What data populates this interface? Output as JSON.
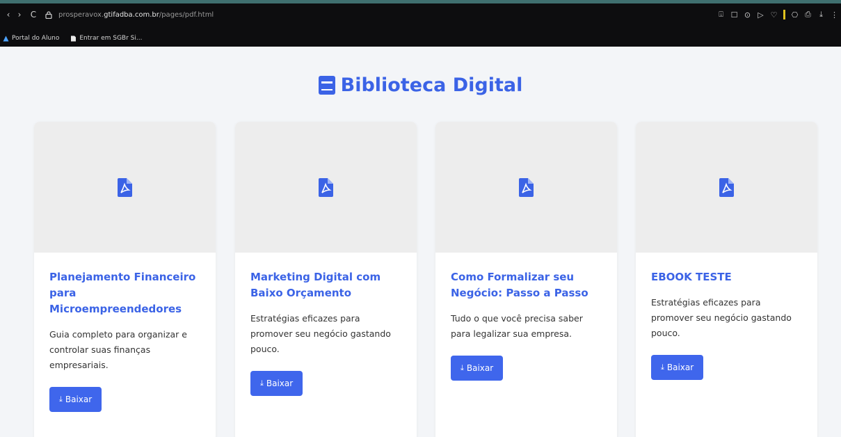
{
  "browser": {
    "url_prefix": "prosperavox.",
    "url_domain": "gtifadba.com.br",
    "url_path": "/pages/pdf.html",
    "nav": {
      "back": "‹",
      "forward": "›",
      "reload": "C"
    },
    "bookmarks": [
      {
        "label": "Portal do Aluno",
        "icon": "portal-icon"
      },
      {
        "label": "Entrar em SGBr Si...",
        "icon": "document-icon"
      }
    ],
    "extensions": [
      "⍗",
      "☐",
      "⊙",
      "▷",
      "♡",
      "⎔",
      "⎙",
      "⤓",
      "⋮"
    ]
  },
  "page": {
    "title": "Biblioteca Digital",
    "accent": "#3b63e6"
  },
  "cards": [
    {
      "title": "Planejamento Financeiro para Microempreendedores",
      "description": "Guia completo para organizar e controlar suas finanças empresariais.",
      "button": "Baixar"
    },
    {
      "title": "Marketing Digital com Baixo Orçamento",
      "description": "Estratégias eficazes para promover seu negócio gastando pouco.",
      "button": "Baixar"
    },
    {
      "title": "Como Formalizar seu Negócio: Passo a Passo",
      "description": "Tudo o que você precisa saber para legalizar sua empresa.",
      "button": "Baixar"
    },
    {
      "title": "EBOOK TESTE",
      "description": "Estratégias eficazes para promover seu negócio gastando pouco.",
      "button": "Baixar"
    }
  ]
}
